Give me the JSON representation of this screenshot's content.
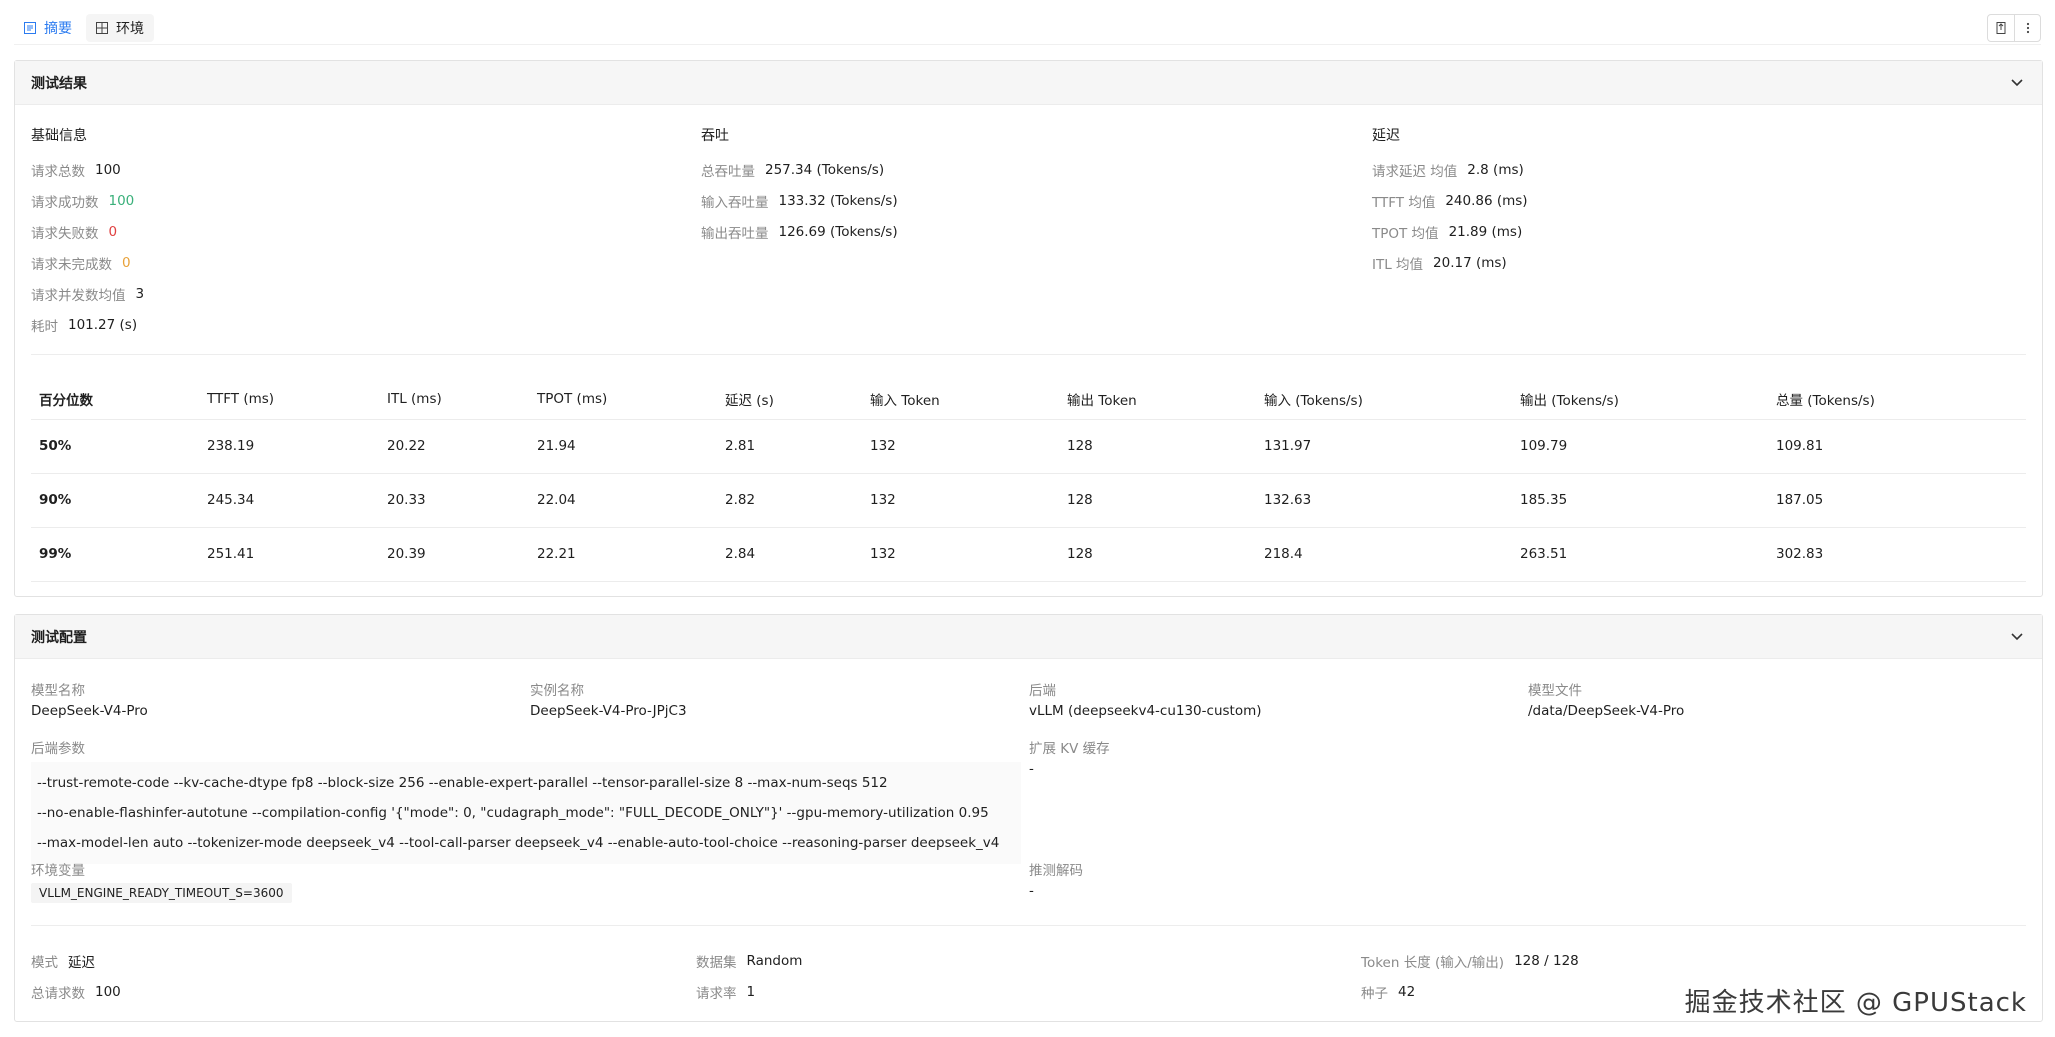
{
  "tabs": [
    {
      "label": "摘要",
      "icon": "summary-icon",
      "active": true
    },
    {
      "label": "环境",
      "icon": "environment-icon",
      "active": false
    }
  ],
  "toolbar": {
    "export_icon": "export-icon",
    "more_icon": "more-vertical-icon"
  },
  "results": {
    "title": "测试结果",
    "basic": {
      "heading": "基础信息",
      "items": [
        {
          "label": "请求总数",
          "value": "100"
        },
        {
          "label": "请求成功数",
          "value": "100"
        },
        {
          "label": "请求失败数",
          "value": "0"
        },
        {
          "label": "请求未完成数",
          "value": "0"
        },
        {
          "label": "请求并发数均值",
          "value": "3"
        },
        {
          "label": "耗时",
          "value": "101.27 (s)"
        }
      ]
    },
    "throughput": {
      "heading": "吞吐",
      "items": [
        {
          "label": "总吞吐量",
          "value": "257.34 (Tokens/s)"
        },
        {
          "label": "输入吞吐量",
          "value": "133.32 (Tokens/s)"
        },
        {
          "label": "输出吞吐量",
          "value": "126.69 (Tokens/s)"
        }
      ]
    },
    "latency": {
      "heading": "延迟",
      "items": [
        {
          "label": "请求延迟 均值",
          "value": "2.8 (ms)"
        },
        {
          "label": "TTFT 均值",
          "value": "240.86 (ms)"
        },
        {
          "label": "TPOT 均值",
          "value": "21.89 (ms)"
        },
        {
          "label": "ITL 均值",
          "value": "20.17 (ms)"
        }
      ]
    },
    "table": {
      "headers": [
        "百分位数",
        "TTFT (ms)",
        "ITL (ms)",
        "TPOT (ms)",
        "延迟 (s)",
        "输入 Token",
        "输出 Token",
        "输入 (Tokens/s)",
        "输出 (Tokens/s)",
        "总量 (Tokens/s)"
      ],
      "rows": [
        [
          "50%",
          "238.19",
          "20.22",
          "21.94",
          "2.81",
          "132",
          "128",
          "131.97",
          "109.79",
          "109.81"
        ],
        [
          "90%",
          "245.34",
          "20.33",
          "22.04",
          "2.82",
          "132",
          "128",
          "132.63",
          "185.35",
          "187.05"
        ],
        [
          "99%",
          "251.41",
          "20.39",
          "22.21",
          "2.84",
          "132",
          "128",
          "218.4",
          "263.51",
          "302.83"
        ]
      ]
    }
  },
  "config": {
    "title": "测试配置",
    "model_name": {
      "label": "模型名称",
      "value": "DeepSeek-V4-Pro"
    },
    "instance_name": {
      "label": "实例名称",
      "value": "DeepSeek-V4-Pro-JPjC3"
    },
    "backend": {
      "label": "后端",
      "value": "vLLM (deepseekv4-cu130-custom)"
    },
    "model_file": {
      "label": "模型文件",
      "value": "/data/DeepSeek-V4-Pro"
    },
    "backend_args": {
      "label": "后端参数",
      "lines": [
        "--trust-remote-code  --kv-cache-dtype fp8  --block-size 256  --enable-expert-parallel  --tensor-parallel-size 8  --max-num-seqs 512",
        "--no-enable-flashinfer-autotune  --compilation-config '{\"mode\": 0, \"cudagraph_mode\": \"FULL_DECODE_ONLY\"}'  --gpu-memory-utilization 0.95",
        "--max-model-len auto  --tokenizer-mode deepseek_v4  --tool-call-parser deepseek_v4  --enable-auto-tool-choice  --reasoning-parser deepseek_v4"
      ]
    },
    "kv_cache": {
      "label": "扩展 KV 缓存",
      "value": "-"
    },
    "env_vars": {
      "label": "环境变量",
      "value": "VLLM_ENGINE_READY_TIMEOUT_S=3600"
    },
    "spec_decode": {
      "label": "推测解码",
      "value": "-"
    },
    "mode": {
      "label": "模式",
      "value": "延迟"
    },
    "dataset": {
      "label": "数据集",
      "value": "Random"
    },
    "token_len": {
      "label": "Token 长度 (输入/输出)",
      "value": "128 / 128"
    },
    "total_requests": {
      "label": "总请求数",
      "value": "100"
    },
    "request_rate": {
      "label": "请求率",
      "value": "1"
    },
    "seed": {
      "label": "种子",
      "value": "42"
    }
  },
  "watermark": "掘金技术社区 @ GPUStack",
  "colors": {
    "accent": "#2b7bf0",
    "success": "#3ab07a",
    "error": "#e04040",
    "warning": "#e8a23a"
  }
}
